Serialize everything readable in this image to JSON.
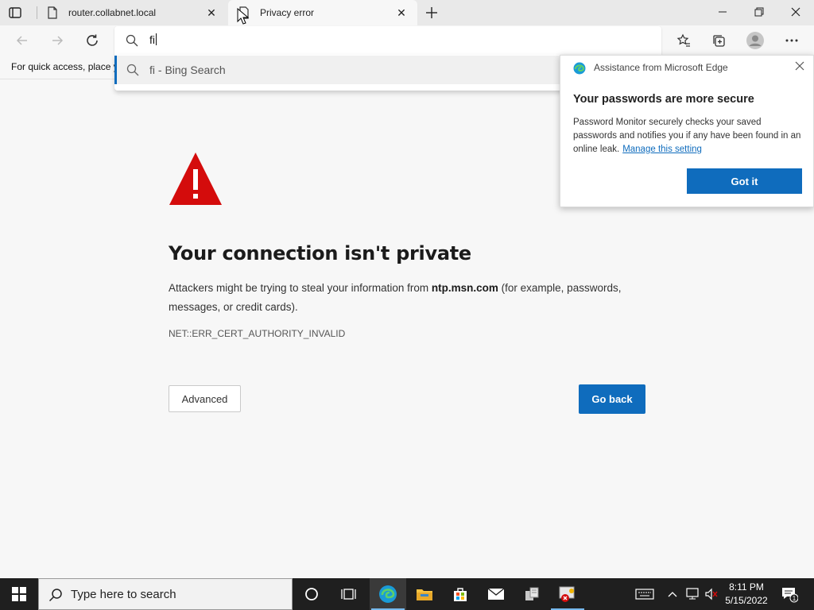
{
  "browser": {
    "tabs": [
      {
        "title": "router.collabnet.local",
        "active": false
      },
      {
        "title": "Privacy error",
        "active": true
      }
    ],
    "address": {
      "typed": "fi"
    },
    "suggestion": {
      "text": "fi - Bing Search"
    },
    "favorites_hint": "For quick access, place y"
  },
  "error_page": {
    "heading": "Your connection isn't private",
    "para_prefix": "Attackers might be trying to steal your information from ",
    "host": "ntp.msn.com",
    "para_suffix": " (for example, passwords, messages, or credit cards).",
    "code": "NET::ERR_CERT_AUTHORITY_INVALID",
    "advanced_label": "Advanced",
    "goback_label": "Go back"
  },
  "popup": {
    "title": "Assistance from Microsoft Edge",
    "heading": "Your passwords are more secure",
    "body": "Password Monitor securely checks your saved passwords and notifies you if any have been found in an online leak.",
    "link": "Manage this setting",
    "button": "Got it"
  },
  "taskbar": {
    "search_placeholder": "Type here to search",
    "time": "8:11 PM",
    "date": "5/15/2022",
    "notification_count": "1"
  },
  "colors": {
    "accent": "#0f6cbd",
    "warning": "#d40c0c",
    "taskbar": "#1f1f1f"
  }
}
